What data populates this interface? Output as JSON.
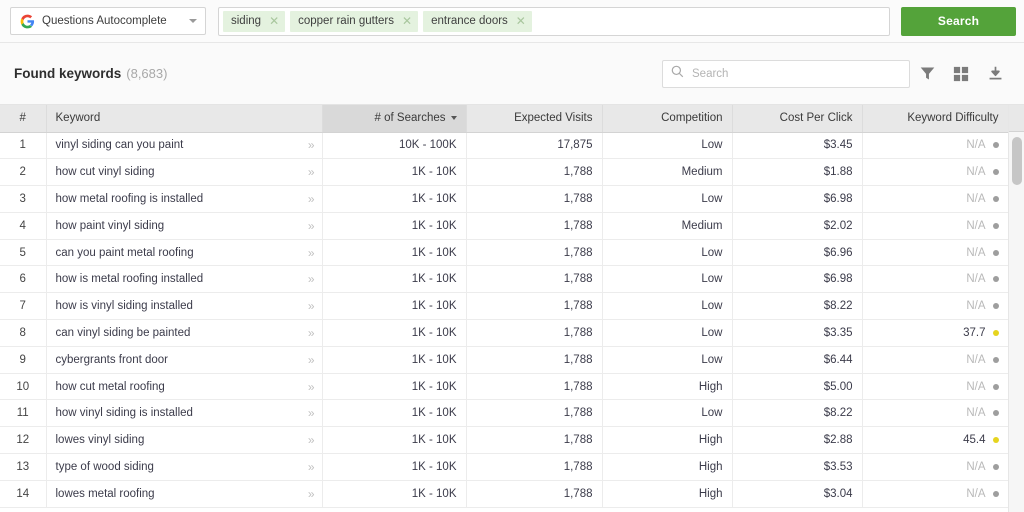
{
  "topbar": {
    "engine_selector": {
      "icon": "google-g-icon",
      "label": "Questions Autocomplete",
      "caret": "chevron-down-icon"
    },
    "tags": [
      {
        "label": "siding",
        "remove_icon": "close-icon"
      },
      {
        "label": "copper rain gutters",
        "remove_icon": "close-icon"
      },
      {
        "label": "entrance doors",
        "remove_icon": "close-icon"
      }
    ],
    "search_button": {
      "label": "Search",
      "color": "#54a33a"
    }
  },
  "subheader": {
    "title": "Found keywords",
    "count": "(8,683)",
    "search": {
      "icon": "search-icon",
      "placeholder": "Search",
      "value": ""
    },
    "icons": [
      {
        "name": "filter-icon"
      },
      {
        "name": "grid-columns-icon"
      },
      {
        "name": "download-icon"
      }
    ]
  },
  "table": {
    "columns": [
      {
        "key": "num",
        "label": "#",
        "align": "center",
        "sorted": false
      },
      {
        "key": "keyword",
        "label": "Keyword",
        "align": "left",
        "sorted": false
      },
      {
        "key": "searches",
        "label": "# of Searches",
        "align": "right",
        "sorted": true,
        "sort_dir": "desc"
      },
      {
        "key": "visits",
        "label": "Expected Visits",
        "align": "right",
        "sorted": false
      },
      {
        "key": "competition",
        "label": "Competition",
        "align": "right",
        "sorted": false
      },
      {
        "key": "cpc",
        "label": "Cost Per Click",
        "align": "right",
        "sorted": false
      },
      {
        "key": "difficulty",
        "label": "Keyword Difficulty",
        "align": "right",
        "sorted": false
      }
    ],
    "dot_colors": {
      "na": "#9e9e9e",
      "value": "#e6d41f"
    },
    "rows": [
      {
        "num": "1",
        "keyword": "vinyl siding can you paint",
        "searches": "10K - 100K",
        "visits": "17,875",
        "competition": "Low",
        "cpc": "$3.45",
        "difficulty": "N/A",
        "dot": "na"
      },
      {
        "num": "2",
        "keyword": "how cut vinyl siding",
        "searches": "1K - 10K",
        "visits": "1,788",
        "competition": "Medium",
        "cpc": "$1.88",
        "difficulty": "N/A",
        "dot": "na"
      },
      {
        "num": "3",
        "keyword": "how metal roofing is installed",
        "searches": "1K - 10K",
        "visits": "1,788",
        "competition": "Low",
        "cpc": "$6.98",
        "difficulty": "N/A",
        "dot": "na"
      },
      {
        "num": "4",
        "keyword": "how paint vinyl siding",
        "searches": "1K - 10K",
        "visits": "1,788",
        "competition": "Medium",
        "cpc": "$2.02",
        "difficulty": "N/A",
        "dot": "na"
      },
      {
        "num": "5",
        "keyword": "can you paint metal roofing",
        "searches": "1K - 10K",
        "visits": "1,788",
        "competition": "Low",
        "cpc": "$6.96",
        "difficulty": "N/A",
        "dot": "na"
      },
      {
        "num": "6",
        "keyword": "how is metal roofing installed",
        "searches": "1K - 10K",
        "visits": "1,788",
        "competition": "Low",
        "cpc": "$6.98",
        "difficulty": "N/A",
        "dot": "na"
      },
      {
        "num": "7",
        "keyword": "how is vinyl siding installed",
        "searches": "1K - 10K",
        "visits": "1,788",
        "competition": "Low",
        "cpc": "$8.22",
        "difficulty": "N/A",
        "dot": "na"
      },
      {
        "num": "8",
        "keyword": "can vinyl siding be painted",
        "searches": "1K - 10K",
        "visits": "1,788",
        "competition": "Low",
        "cpc": "$3.35",
        "difficulty": "37.7",
        "dot": "value"
      },
      {
        "num": "9",
        "keyword": "cybergrants front door",
        "searches": "1K - 10K",
        "visits": "1,788",
        "competition": "Low",
        "cpc": "$6.44",
        "difficulty": "N/A",
        "dot": "na"
      },
      {
        "num": "10",
        "keyword": "how cut metal roofing",
        "searches": "1K - 10K",
        "visits": "1,788",
        "competition": "High",
        "cpc": "$5.00",
        "difficulty": "N/A",
        "dot": "na"
      },
      {
        "num": "11",
        "keyword": "how vinyl siding is installed",
        "searches": "1K - 10K",
        "visits": "1,788",
        "competition": "Low",
        "cpc": "$8.22",
        "difficulty": "N/A",
        "dot": "na"
      },
      {
        "num": "12",
        "keyword": "lowes vinyl siding",
        "searches": "1K - 10K",
        "visits": "1,788",
        "competition": "High",
        "cpc": "$2.88",
        "difficulty": "45.4",
        "dot": "value"
      },
      {
        "num": "13",
        "keyword": "type of wood siding",
        "searches": "1K - 10K",
        "visits": "1,788",
        "competition": "High",
        "cpc": "$3.53",
        "difficulty": "N/A",
        "dot": "na"
      },
      {
        "num": "14",
        "keyword": "lowes metal roofing",
        "searches": "1K - 10K",
        "visits": "1,788",
        "competition": "High",
        "cpc": "$3.04",
        "difficulty": "N/A",
        "dot": "na"
      }
    ],
    "row_expand_icon": "chevron-right-double-icon"
  }
}
